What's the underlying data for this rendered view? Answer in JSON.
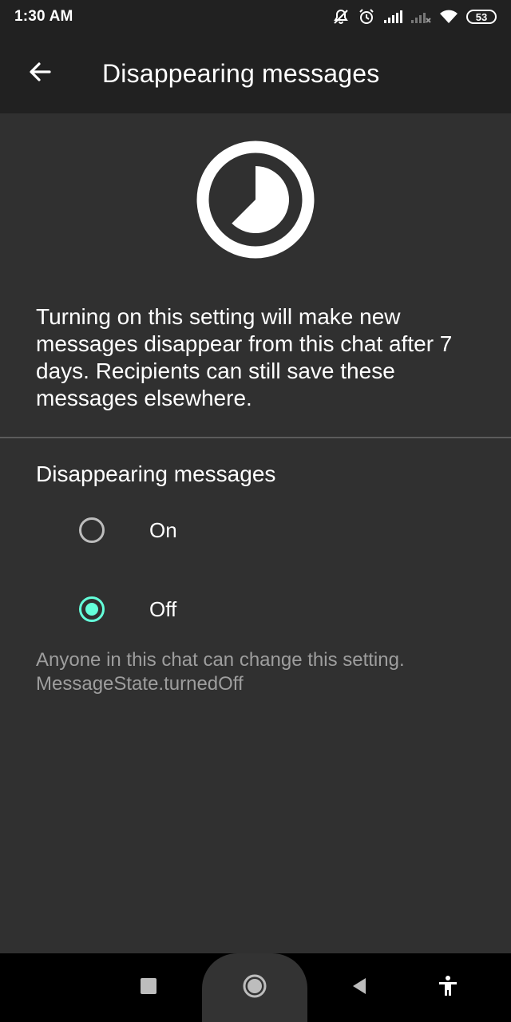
{
  "status_bar": {
    "time": "1:30 AM",
    "battery": "53",
    "icons": [
      "alarm-off-icon",
      "alarm-clock-icon",
      "signal-icon",
      "signal-no-service-icon",
      "wifi-icon",
      "battery-icon"
    ]
  },
  "app_bar": {
    "title": "Disappearing messages",
    "back_icon": "arrow-left-icon"
  },
  "hero_icon": "timer-icon",
  "description": "Turning on this setting will make new messages disappear from this chat after 7 days. Recipients can still save these messages elsewhere.",
  "section": {
    "title": "Disappearing messages",
    "options": [
      {
        "label": "On",
        "selected": false
      },
      {
        "label": "Off",
        "selected": true
      }
    ]
  },
  "footnote": {
    "line1": "Anyone in this chat can change this setting.",
    "line2": "MessageState.turnedOff"
  },
  "colors": {
    "accent": "#64ffda",
    "background": "#303030",
    "app_bar": "#212121",
    "secondary_text": "#9e9e9e"
  },
  "nav_bar": {
    "icons": [
      "recents-square-icon",
      "home-circle-icon",
      "back-triangle-icon",
      "accessibility-icon"
    ]
  }
}
